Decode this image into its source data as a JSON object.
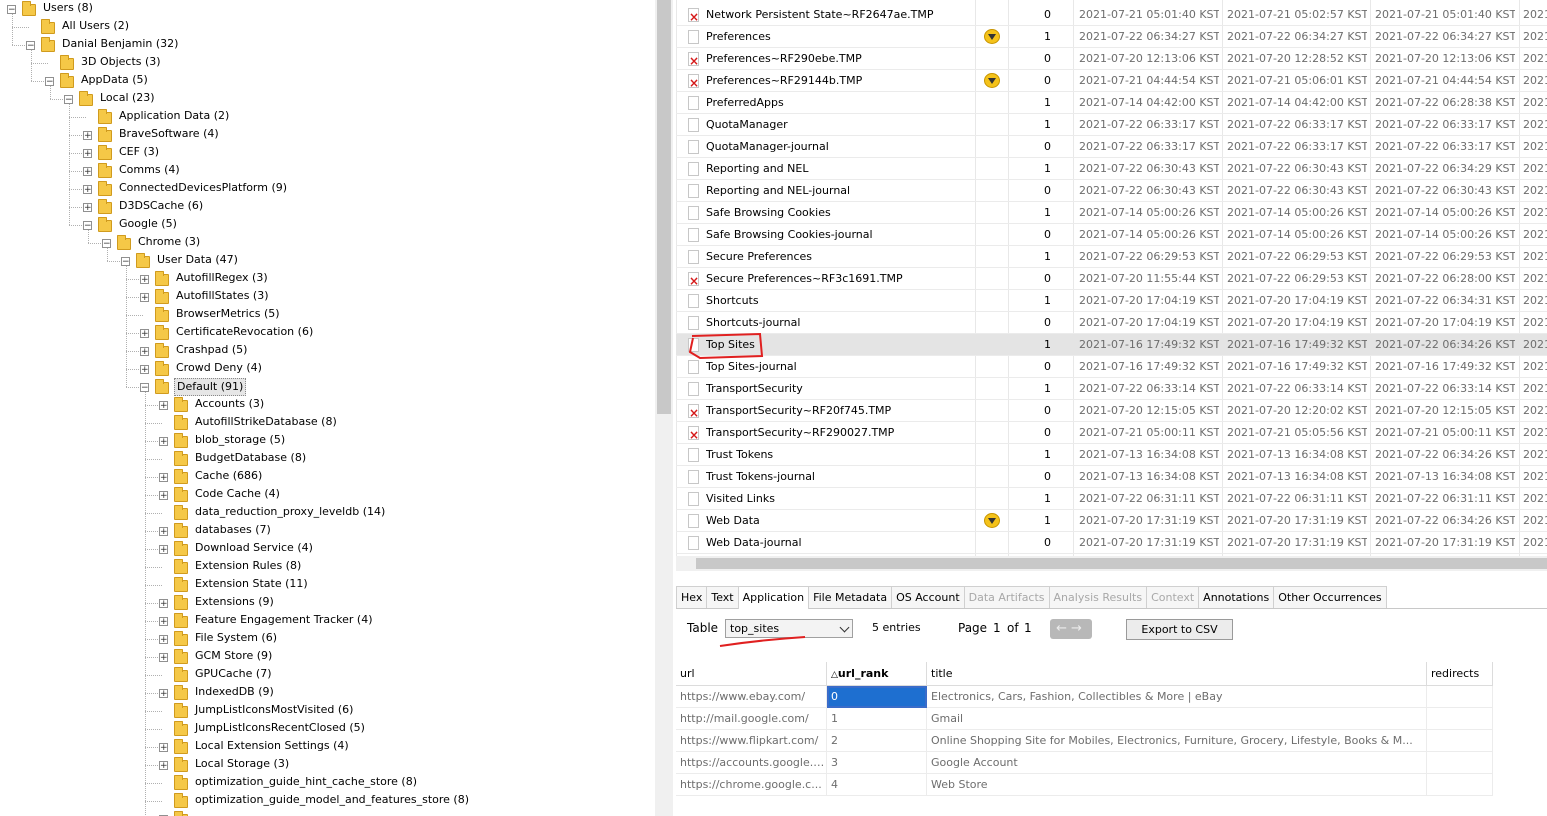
{
  "tree": {
    "nodes": [
      {
        "label": "Users (8)",
        "depth": 0,
        "toggle": "-"
      },
      {
        "label": "All Users (2)",
        "depth": 1,
        "toggle": ""
      },
      {
        "label": "Danial Benjamin (32)",
        "depth": 1,
        "toggle": "-"
      },
      {
        "label": "3D Objects (3)",
        "depth": 2,
        "toggle": ""
      },
      {
        "label": "AppData (5)",
        "depth": 2,
        "toggle": "-"
      },
      {
        "label": "Local (23)",
        "depth": 3,
        "toggle": "-"
      },
      {
        "label": "Application Data (2)",
        "depth": 4,
        "toggle": ""
      },
      {
        "label": "BraveSoftware (4)",
        "depth": 4,
        "toggle": "+"
      },
      {
        "label": "CEF (3)",
        "depth": 4,
        "toggle": "+"
      },
      {
        "label": "Comms (4)",
        "depth": 4,
        "toggle": "+"
      },
      {
        "label": "ConnectedDevicesPlatform (9)",
        "depth": 4,
        "toggle": "+"
      },
      {
        "label": "D3DSCache (6)",
        "depth": 4,
        "toggle": "+"
      },
      {
        "label": "Google (5)",
        "depth": 4,
        "toggle": "-"
      },
      {
        "label": "Chrome (3)",
        "depth": 5,
        "toggle": "-"
      },
      {
        "label": "User Data (47)",
        "depth": 6,
        "toggle": "-"
      },
      {
        "label": "AutofillRegex (3)",
        "depth": 7,
        "toggle": "+"
      },
      {
        "label": "AutofillStates (3)",
        "depth": 7,
        "toggle": "+"
      },
      {
        "label": "BrowserMetrics (5)",
        "depth": 7,
        "toggle": ""
      },
      {
        "label": "CertificateRevocation (6)",
        "depth": 7,
        "toggle": "+"
      },
      {
        "label": "Crashpad (5)",
        "depth": 7,
        "toggle": "+"
      },
      {
        "label": "Crowd Deny (4)",
        "depth": 7,
        "toggle": "+"
      },
      {
        "label": "Default (91)",
        "depth": 7,
        "toggle": "-",
        "selected": true
      },
      {
        "label": "Accounts (3)",
        "depth": 8,
        "toggle": "+"
      },
      {
        "label": "AutofillStrikeDatabase (8)",
        "depth": 8,
        "toggle": ""
      },
      {
        "label": "blob_storage (5)",
        "depth": 8,
        "toggle": "+"
      },
      {
        "label": "BudgetDatabase (8)",
        "depth": 8,
        "toggle": ""
      },
      {
        "label": "Cache (686)",
        "depth": 8,
        "toggle": "+"
      },
      {
        "label": "Code Cache (4)",
        "depth": 8,
        "toggle": "+"
      },
      {
        "label": "data_reduction_proxy_leveldb (14)",
        "depth": 8,
        "toggle": ""
      },
      {
        "label": "databases (7)",
        "depth": 8,
        "toggle": "+"
      },
      {
        "label": "Download Service (4)",
        "depth": 8,
        "toggle": "+"
      },
      {
        "label": "Extension Rules (8)",
        "depth": 8,
        "toggle": ""
      },
      {
        "label": "Extension State (11)",
        "depth": 8,
        "toggle": ""
      },
      {
        "label": "Extensions (9)",
        "depth": 8,
        "toggle": "+"
      },
      {
        "label": "Feature Engagement Tracker (4)",
        "depth": 8,
        "toggle": "+"
      },
      {
        "label": "File System (6)",
        "depth": 8,
        "toggle": "+"
      },
      {
        "label": "GCM Store (9)",
        "depth": 8,
        "toggle": "+"
      },
      {
        "label": "GPUCache (7)",
        "depth": 8,
        "toggle": ""
      },
      {
        "label": "IndexedDB (9)",
        "depth": 8,
        "toggle": "+"
      },
      {
        "label": "JumpListIconsMostVisited (6)",
        "depth": 8,
        "toggle": ""
      },
      {
        "label": "JumpListIconsRecentClosed (5)",
        "depth": 8,
        "toggle": ""
      },
      {
        "label": "Local Extension Settings (4)",
        "depth": 8,
        "toggle": "+"
      },
      {
        "label": "Local Storage (3)",
        "depth": 8,
        "toggle": "+"
      },
      {
        "label": "optimization_guide_hint_cache_store (8)",
        "depth": 8,
        "toggle": ""
      },
      {
        "label": "optimization_guide_model_and_features_store (8)",
        "depth": 8,
        "toggle": ""
      },
      {
        "label": "",
        "depth": 8,
        "toggle": "+"
      }
    ]
  },
  "files": {
    "rows": [
      {
        "name": "Network Persistent State~RF2647ae.TMP",
        "deleted": true,
        "warn": false,
        "count": "0",
        "d1": "2021-07-21 05:01:40 KST",
        "d2": "2021-07-21 05:02:57 KST",
        "d3": "2021-07-21 05:01:40 KST",
        "d4": "2021"
      },
      {
        "name": "Preferences",
        "deleted": false,
        "warn": true,
        "count": "1",
        "d1": "2021-07-22 06:34:27 KST",
        "d2": "2021-07-22 06:34:27 KST",
        "d3": "2021-07-22 06:34:27 KST",
        "d4": "2021"
      },
      {
        "name": "Preferences~RF290ebe.TMP",
        "deleted": true,
        "warn": false,
        "count": "0",
        "d1": "2021-07-20 12:13:06 KST",
        "d2": "2021-07-20 12:28:52 KST",
        "d3": "2021-07-20 12:13:06 KST",
        "d4": "2021"
      },
      {
        "name": "Preferences~RF29144b.TMP",
        "deleted": true,
        "warn": true,
        "count": "0",
        "d1": "2021-07-21 04:44:54 KST",
        "d2": "2021-07-21 05:06:01 KST",
        "d3": "2021-07-21 04:44:54 KST",
        "d4": "2021"
      },
      {
        "name": "PreferredApps",
        "deleted": false,
        "warn": false,
        "count": "1",
        "d1": "2021-07-14 04:42:00 KST",
        "d2": "2021-07-14 04:42:00 KST",
        "d3": "2021-07-22 06:28:38 KST",
        "d4": "2021"
      },
      {
        "name": "QuotaManager",
        "deleted": false,
        "warn": false,
        "count": "1",
        "d1": "2021-07-22 06:33:17 KST",
        "d2": "2021-07-22 06:33:17 KST",
        "d3": "2021-07-22 06:33:17 KST",
        "d4": "2021"
      },
      {
        "name": "QuotaManager-journal",
        "deleted": false,
        "warn": false,
        "count": "0",
        "d1": "2021-07-22 06:33:17 KST",
        "d2": "2021-07-22 06:33:17 KST",
        "d3": "2021-07-22 06:33:17 KST",
        "d4": "2021"
      },
      {
        "name": "Reporting and NEL",
        "deleted": false,
        "warn": false,
        "count": "1",
        "d1": "2021-07-22 06:30:43 KST",
        "d2": "2021-07-22 06:30:43 KST",
        "d3": "2021-07-22 06:34:29 KST",
        "d4": "2021"
      },
      {
        "name": "Reporting and NEL-journal",
        "deleted": false,
        "warn": false,
        "count": "0",
        "d1": "2021-07-22 06:30:43 KST",
        "d2": "2021-07-22 06:30:43 KST",
        "d3": "2021-07-22 06:30:43 KST",
        "d4": "2021"
      },
      {
        "name": "Safe Browsing Cookies",
        "deleted": false,
        "warn": false,
        "count": "1",
        "d1": "2021-07-14 05:00:26 KST",
        "d2": "2021-07-14 05:00:26 KST",
        "d3": "2021-07-14 05:00:26 KST",
        "d4": "2021"
      },
      {
        "name": "Safe Browsing Cookies-journal",
        "deleted": false,
        "warn": false,
        "count": "0",
        "d1": "2021-07-14 05:00:26 KST",
        "d2": "2021-07-14 05:00:26 KST",
        "d3": "2021-07-14 05:00:26 KST",
        "d4": "2021"
      },
      {
        "name": "Secure Preferences",
        "deleted": false,
        "warn": false,
        "count": "1",
        "d1": "2021-07-22 06:29:53 KST",
        "d2": "2021-07-22 06:29:53 KST",
        "d3": "2021-07-22 06:29:53 KST",
        "d4": "2021"
      },
      {
        "name": "Secure Preferences~RF3c1691.TMP",
        "deleted": true,
        "warn": false,
        "count": "0",
        "d1": "2021-07-20 11:55:44 KST",
        "d2": "2021-07-22 06:29:53 KST",
        "d3": "2021-07-22 06:28:00 KST",
        "d4": "2021"
      },
      {
        "name": "Shortcuts",
        "deleted": false,
        "warn": false,
        "count": "1",
        "d1": "2021-07-20 17:04:19 KST",
        "d2": "2021-07-20 17:04:19 KST",
        "d3": "2021-07-22 06:34:31 KST",
        "d4": "2021"
      },
      {
        "name": "Shortcuts-journal",
        "deleted": false,
        "warn": false,
        "count": "0",
        "d1": "2021-07-20 17:04:19 KST",
        "d2": "2021-07-20 17:04:19 KST",
        "d3": "2021-07-20 17:04:19 KST",
        "d4": "2021"
      },
      {
        "name": "Top Sites",
        "deleted": false,
        "warn": false,
        "count": "1",
        "d1": "2021-07-16 17:49:32 KST",
        "d2": "2021-07-16 17:49:32 KST",
        "d3": "2021-07-22 06:34:26 KST",
        "d4": "2021",
        "selected": true
      },
      {
        "name": "Top Sites-journal",
        "deleted": false,
        "warn": false,
        "count": "0",
        "d1": "2021-07-16 17:49:32 KST",
        "d2": "2021-07-16 17:49:32 KST",
        "d3": "2021-07-16 17:49:32 KST",
        "d4": "2021"
      },
      {
        "name": "TransportSecurity",
        "deleted": false,
        "warn": false,
        "count": "1",
        "d1": "2021-07-22 06:33:14 KST",
        "d2": "2021-07-22 06:33:14 KST",
        "d3": "2021-07-22 06:33:14 KST",
        "d4": "2021"
      },
      {
        "name": "TransportSecurity~RF20f745.TMP",
        "deleted": true,
        "warn": false,
        "count": "0",
        "d1": "2021-07-20 12:15:05 KST",
        "d2": "2021-07-20 12:20:02 KST",
        "d3": "2021-07-20 12:15:05 KST",
        "d4": "2021"
      },
      {
        "name": "TransportSecurity~RF290027.TMP",
        "deleted": true,
        "warn": false,
        "count": "0",
        "d1": "2021-07-21 05:00:11 KST",
        "d2": "2021-07-21 05:05:56 KST",
        "d3": "2021-07-21 05:00:11 KST",
        "d4": "2021"
      },
      {
        "name": "Trust Tokens",
        "deleted": false,
        "warn": false,
        "count": "1",
        "d1": "2021-07-13 16:34:08 KST",
        "d2": "2021-07-13 16:34:08 KST",
        "d3": "2021-07-22 06:34:26 KST",
        "d4": "2021"
      },
      {
        "name": "Trust Tokens-journal",
        "deleted": false,
        "warn": false,
        "count": "0",
        "d1": "2021-07-13 16:34:08 KST",
        "d2": "2021-07-13 16:34:08 KST",
        "d3": "2021-07-13 16:34:08 KST",
        "d4": "2021"
      },
      {
        "name": "Visited Links",
        "deleted": false,
        "warn": false,
        "count": "1",
        "d1": "2021-07-22 06:31:11 KST",
        "d2": "2021-07-22 06:31:11 KST",
        "d3": "2021-07-22 06:31:11 KST",
        "d4": "2021"
      },
      {
        "name": "Web Data",
        "deleted": false,
        "warn": true,
        "count": "1",
        "d1": "2021-07-20 17:31:19 KST",
        "d2": "2021-07-20 17:31:19 KST",
        "d3": "2021-07-22 06:34:26 KST",
        "d4": "2021"
      },
      {
        "name": "Web Data-journal",
        "deleted": false,
        "warn": false,
        "count": "0",
        "d1": "2021-07-20 17:31:19 KST",
        "d2": "2021-07-20 17:31:19 KST",
        "d3": "2021-07-20 17:31:19 KST",
        "d4": "2021"
      }
    ]
  },
  "tabs": [
    {
      "label": "Hex",
      "state": "normal"
    },
    {
      "label": "Text",
      "state": "normal"
    },
    {
      "label": "Application",
      "state": "active"
    },
    {
      "label": "File Metadata",
      "state": "normal"
    },
    {
      "label": "OS Account",
      "state": "normal"
    },
    {
      "label": "Data Artifacts",
      "state": "disabled"
    },
    {
      "label": "Analysis Results",
      "state": "disabled"
    },
    {
      "label": "Context",
      "state": "disabled"
    },
    {
      "label": "Annotations",
      "state": "normal"
    },
    {
      "label": "Other Occurrences",
      "state": "normal"
    }
  ],
  "viewer": {
    "table_label": "Table",
    "table_selected": "top_sites",
    "entries": "5 entries",
    "page_label": "Page",
    "page_current": "1",
    "page_of": "of",
    "page_total": "1",
    "nav_arrows": "←→",
    "export_label": "Export to CSV",
    "columns": [
      {
        "label": "url",
        "sort": ""
      },
      {
        "label": "url_rank",
        "sort": "△"
      },
      {
        "label": "title",
        "sort": ""
      },
      {
        "label": "redirects",
        "sort": ""
      }
    ],
    "rows": [
      [
        "https://www.ebay.com/",
        "0",
        "Electronics, Cars, Fashion, Collectibles & More | eBay",
        ""
      ],
      [
        "http://mail.google.com/",
        "1",
        "Gmail",
        ""
      ],
      [
        "https://www.flipkart.com/",
        "2",
        "Online Shopping Site for Mobiles, Electronics, Furniture, Grocery, Lifestyle, Books & M...",
        ""
      ],
      [
        "https://accounts.google.c...",
        "3",
        "Google Account",
        ""
      ],
      [
        "https://chrome.google.c...",
        "4",
        "Web Store",
        ""
      ]
    ]
  },
  "colors": {
    "annotation": "#e02020",
    "warn": "#f4c21a",
    "deleted": "#d51a1a",
    "focus": "#1e6fd0"
  }
}
